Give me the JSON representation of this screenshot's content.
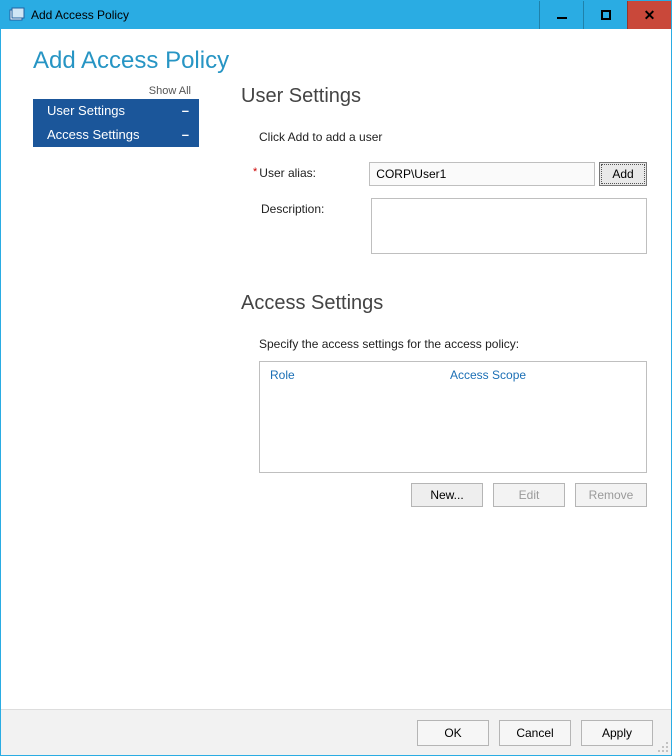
{
  "window": {
    "title": "Add Access Policy"
  },
  "header": {
    "title": "Add Access Policy"
  },
  "sidebar": {
    "show_all": "Show All",
    "items": [
      {
        "label": "User Settings"
      },
      {
        "label": "Access Settings"
      }
    ]
  },
  "user_settings": {
    "title": "User Settings",
    "hint": "Click Add to add a user",
    "alias_label": "User alias:",
    "alias_value": "CORP\\User1",
    "add_label": "Add",
    "description_label": "Description:",
    "description_value": ""
  },
  "access_settings": {
    "title": "Access Settings",
    "hint": "Specify the access settings for the access policy:",
    "columns": {
      "role": "Role",
      "scope": "Access Scope"
    },
    "buttons": {
      "new": "New...",
      "edit": "Edit",
      "remove": "Remove"
    }
  },
  "footer": {
    "ok": "OK",
    "cancel": "Cancel",
    "apply": "Apply"
  }
}
